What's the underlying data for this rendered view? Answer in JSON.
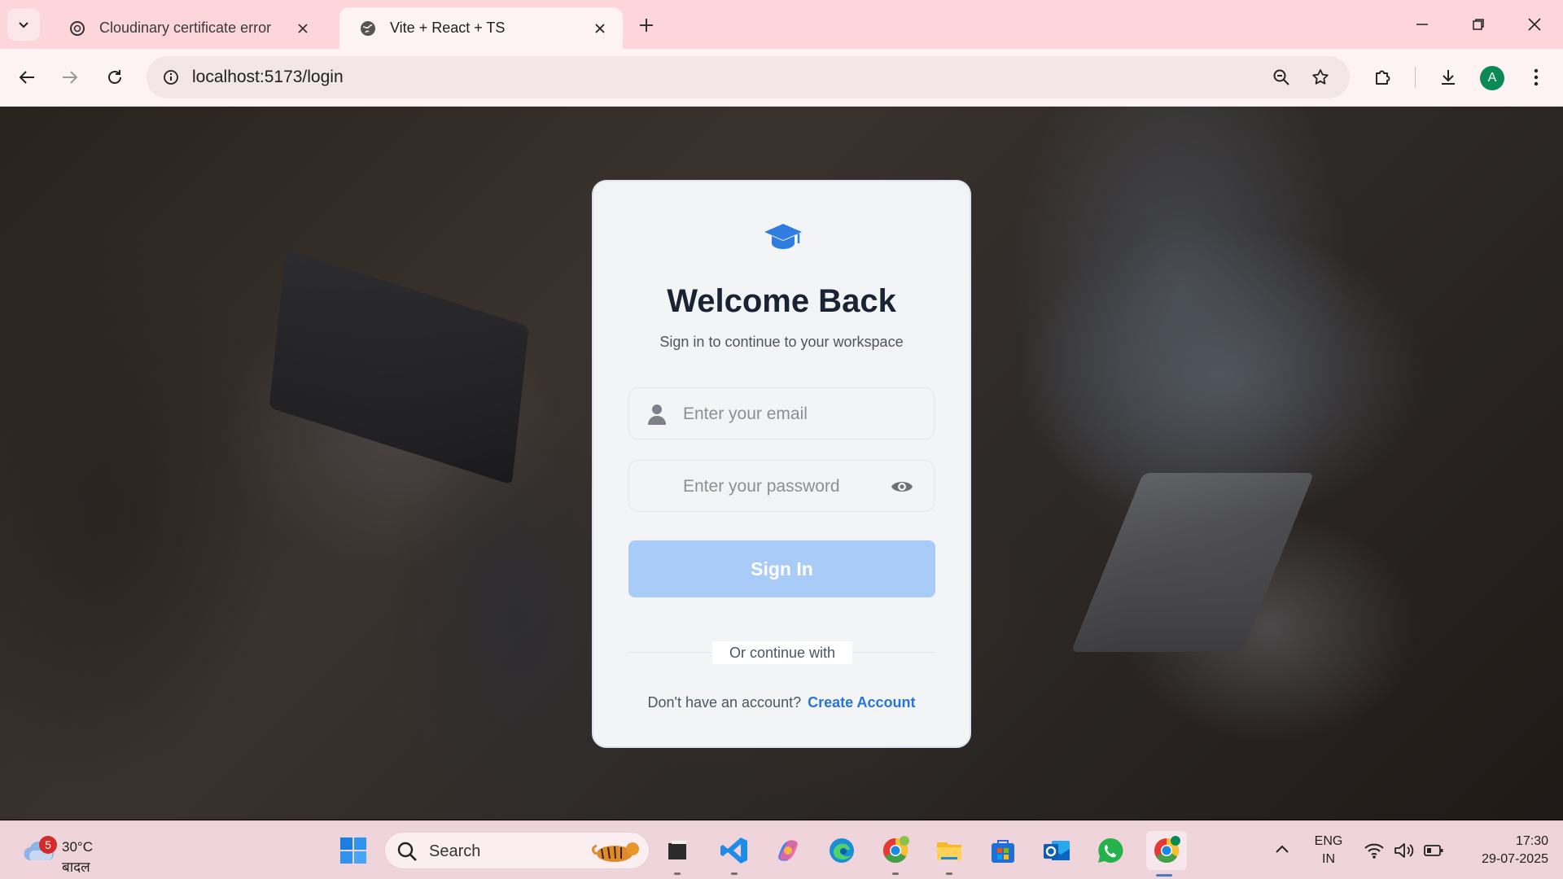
{
  "browser": {
    "tabs": [
      {
        "title": "Cloudinary certificate error",
        "icon": "openai-icon",
        "active": false
      },
      {
        "title": "Vite + React + TS",
        "icon": "globe-icon",
        "active": true
      }
    ],
    "url": "localhost:5173/login",
    "profile_initial": "A"
  },
  "login": {
    "title": "Welcome Back",
    "subtitle": "Sign in to continue to your workspace",
    "email_placeholder": "Enter your email",
    "password_placeholder": "Enter your password",
    "sign_in_label": "Sign In",
    "divider_label": "Or continue with",
    "no_account_text": "Don't have an account?",
    "create_account_label": "Create Account",
    "accent_color": "#2776d6",
    "button_color": "#a8cbf7"
  },
  "taskbar": {
    "weather": {
      "badge": "5",
      "temperature": "30°C",
      "condition": "बादल"
    },
    "search_label": "Search",
    "language": {
      "line1": "ENG",
      "line2": "IN"
    },
    "time": "17:30",
    "date": "29-07-2025",
    "apps": [
      "windows-start-icon",
      "file-manager-icon",
      "vscode-icon",
      "copilot-icon",
      "edge-icon",
      "chrome-icon",
      "file-explorer-icon",
      "microsoft-store-icon",
      "outlook-icon",
      "whatsapp-icon",
      "chrome-profile-icon"
    ]
  }
}
